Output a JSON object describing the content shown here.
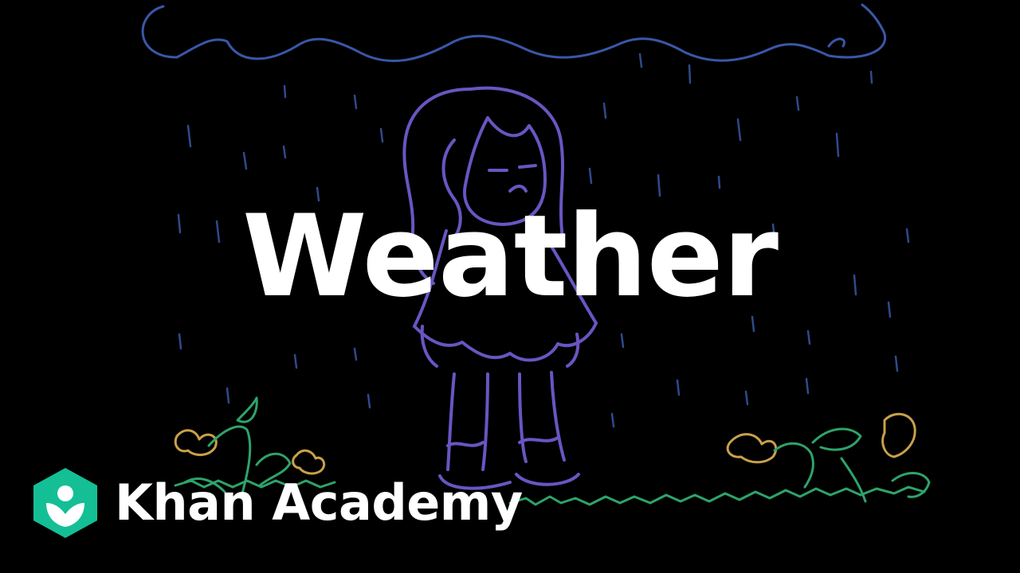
{
  "video_title": "Weather",
  "brand": {
    "name": "Khan Academy",
    "logo_icon": "khan-academy-hexagon-logo",
    "logo_color": "#14bf96"
  },
  "palette": {
    "background": "#000000",
    "cloud": "#3a57a8",
    "rain": "#2f4a8c",
    "figure": "#6a55c2",
    "flower": "#c9a14a",
    "grass": "#2ea36a",
    "text": "#ffffff"
  }
}
